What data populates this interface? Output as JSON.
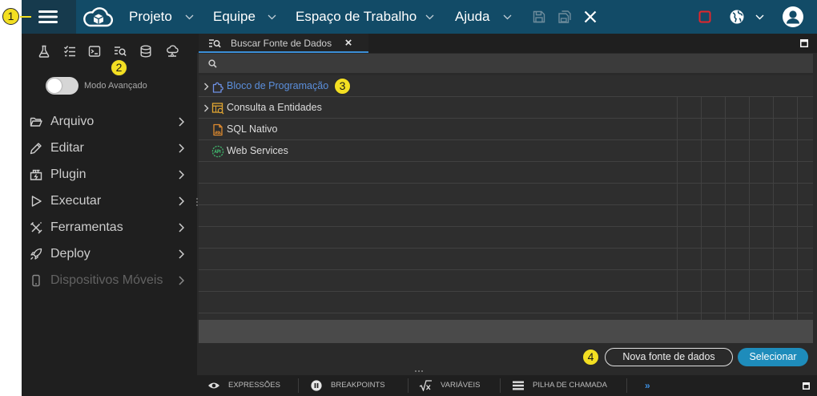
{
  "callouts": {
    "one": "1",
    "two": "2",
    "three": "3",
    "four": "4"
  },
  "topbar": {
    "logo_icon": "cloud-cube-logo-icon",
    "menu": [
      {
        "label": "Projeto"
      },
      {
        "label": "Equipe"
      },
      {
        "label": "Espaço de Trabalho"
      },
      {
        "label": "Ajuda"
      }
    ],
    "actions": [
      {
        "icon": "save-icon",
        "enabled": false
      },
      {
        "icon": "save-all-icon",
        "enabled": false
      },
      {
        "icon": "close-icon",
        "enabled": true
      },
      {
        "icon": "stop-icon",
        "enabled": true
      },
      {
        "icon": "globe-icon",
        "enabled": true
      },
      {
        "icon": "user-avatar-icon",
        "enabled": true
      }
    ]
  },
  "sidebar": {
    "tools": [
      {
        "icon": "flask-icon"
      },
      {
        "icon": "checklist-icon"
      },
      {
        "icon": "terminal-icon"
      },
      {
        "icon": "search-data-icon"
      },
      {
        "icon": "database-icon"
      },
      {
        "icon": "cloud-settings-icon"
      }
    ],
    "advanced_mode": {
      "label": "Modo Avançado",
      "on": false
    },
    "items": [
      {
        "label": "Arquivo",
        "icon": "folder-icon",
        "enabled": true
      },
      {
        "label": "Editar",
        "icon": "pencil-icon",
        "enabled": true
      },
      {
        "label": "Plugin",
        "icon": "plugin-icon",
        "enabled": true
      },
      {
        "label": "Executar",
        "icon": "play-icon",
        "enabled": true
      },
      {
        "label": "Ferramentas",
        "icon": "tools-icon",
        "enabled": true
      },
      {
        "label": "Deploy",
        "icon": "rocket-icon",
        "enabled": true
      },
      {
        "label": "Dispositivos Móveis",
        "icon": "mobile-icon",
        "enabled": false
      }
    ]
  },
  "panel": {
    "tab": {
      "label": "Buscar Fonte de Dados",
      "close": "×",
      "icon": "search-data-icon"
    },
    "search": {
      "value": ""
    },
    "tree": [
      {
        "label": "Bloco de Programação",
        "icon": "puzzle-icon",
        "expandable": true
      },
      {
        "label": "Consulta a Entidades",
        "icon": "entity-query-icon",
        "expandable": true
      },
      {
        "label": "SQL Nativo",
        "icon": "sql-file-icon",
        "expandable": false
      },
      {
        "label": "Web Services",
        "icon": "api-icon",
        "expandable": false
      }
    ],
    "buttons": {
      "new_source": "Nova fonte de dados",
      "select": "Selecionar"
    }
  },
  "bottom_tabs": [
    {
      "label": "EXPRESSÕES",
      "icon": "eye-icon"
    },
    {
      "label": "BREAKPOINTS",
      "icon": "pause-circle-icon"
    },
    {
      "label": "VARIÁVEIS",
      "icon": "sqrt-x-icon"
    },
    {
      "label": "PILHA DE CHAMADA",
      "icon": "list-icon"
    }
  ],
  "bottom_more": "»",
  "colors": {
    "topbar": "#124b67",
    "topbar_menu_block": "#163a4d",
    "sidebar": "#1f1f1f",
    "panel": "#2a2a2a",
    "accent": "#1e8cbb",
    "tab_underline": "#3b8ed6",
    "link": "#5b8fdc",
    "stop": "#e3262b",
    "callout": "#f3df22"
  }
}
